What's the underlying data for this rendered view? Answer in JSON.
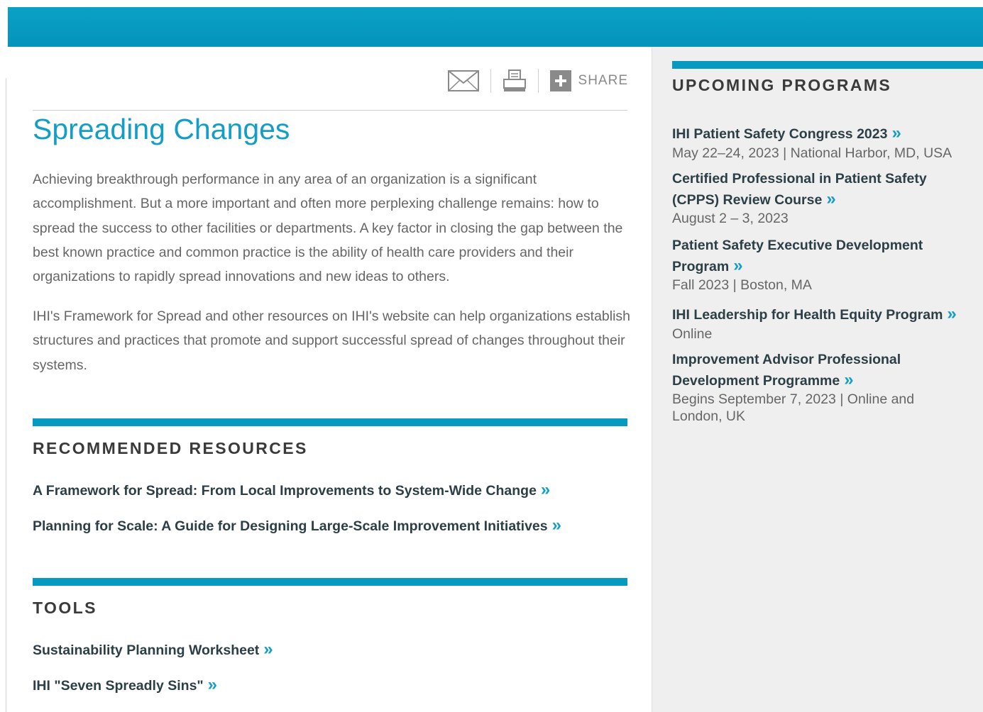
{
  "toolbar": {
    "share_label": "SHARE"
  },
  "page": {
    "title": "Spreading Changes",
    "paragraphs": [
      "Achieving breakthrough performance in any area of an organization is a significant accomplishment. But a more important and often more perplexing challenge remains: how to spread the success to other facilities or departments. A key factor in closing the gap between the best known practice and common practice is the ability of health care providers and their organizations to rapidly spread innovations and new ideas to others.",
      "IHI's Framework for Spread and other resources on IHI's website can help organizations establish structures and practices that promote and support successful spread of changes throughout their systems."
    ]
  },
  "recommended": {
    "heading": "RECOMMENDED RESOURCES",
    "items": [
      "A Framework for Spread: From Local Improvements to System-Wide Change",
      "Planning for Scale: A Guide for Designing Large-Scale Improvement Initiatives"
    ]
  },
  "tools": {
    "heading": "TOOLS",
    "items": [
      "Sustainability Planning Worksheet",
      "IHI \"Seven Spreadly Sins\""
    ]
  },
  "sidebar": {
    "heading": "UPCOMING PROGRAMS",
    "programs": [
      {
        "line1": "IHI Patient Safety Congress 2023",
        "line2": "",
        "meta1": "May 22–24, 2023 | National Harbor, MD, USA",
        "meta2": ""
      },
      {
        "line1": "Certified Professional in Patient Safety",
        "line2": "(CPPS) Review Course",
        "meta1": "August 2 – 3, 2023",
        "meta2": ""
      },
      {
        "line1": "Patient Safety Executive Development",
        "line2": "Program",
        "meta1": "Fall 2023 | Boston, MA",
        "meta2": ""
      },
      {
        "line1": "IHI Leadership for Health Equity Program",
        "line2": "",
        "meta1": "Online",
        "meta2": ""
      },
      {
        "line1": "Improvement Advisor Professional",
        "line2": "Development Programme",
        "meta1": "Begins September 7, 2023 | Online and",
        "meta2": "London, UK"
      }
    ]
  },
  "chevron": "»",
  "colors": {
    "header_blue": "#069ac0",
    "title_blue": "#149ec5",
    "sidebar_bg": "#efefef"
  },
  "icons": [
    "email-icon",
    "print-icon",
    "plus-icon"
  ]
}
